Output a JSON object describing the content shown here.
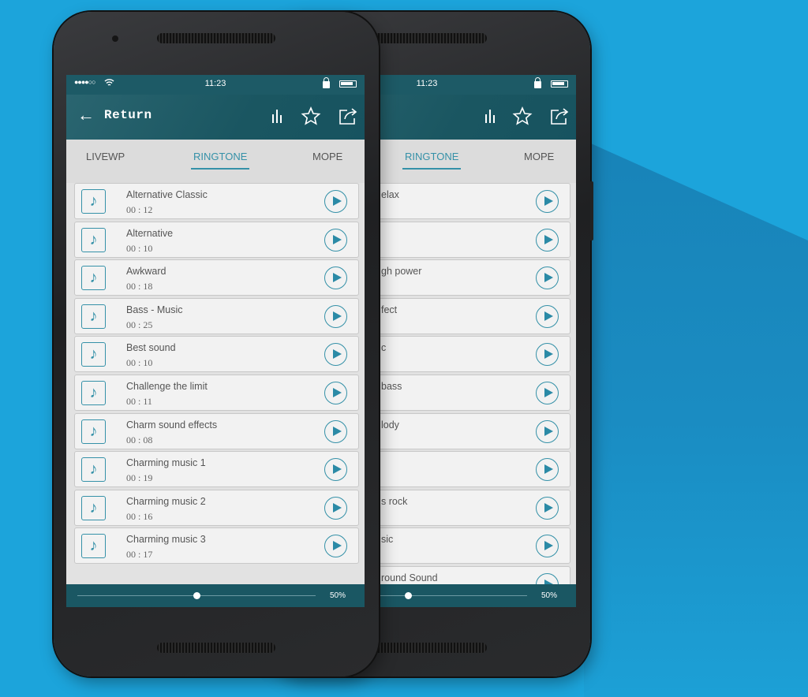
{
  "colors": {
    "background": "#1ca4db",
    "header": "#1d5a66",
    "accent": "#3591a8"
  },
  "status": {
    "time": "11:23",
    "signal": "●●●●○○"
  },
  "header": {
    "back_label": "Return",
    "icons": [
      "back-arrow-icon",
      "equalizer-icon",
      "star-icon",
      "share-icon"
    ]
  },
  "tabs": [
    {
      "label": "LIVEWP"
    },
    {
      "label": "RINGTONE",
      "active": true
    },
    {
      "label": "MOPE"
    }
  ],
  "front_list": [
    {
      "name": "Alternative Classic",
      "duration": "00 : 12"
    },
    {
      "name": "Alternative",
      "duration": "00 : 10"
    },
    {
      "name": "Awkward",
      "duration": "00 : 18"
    },
    {
      "name": "Bass - Music",
      "duration": "00 : 25"
    },
    {
      "name": "Best sound",
      "duration": "00 : 10"
    },
    {
      "name": "Challenge the limit",
      "duration": "00 : 11"
    },
    {
      "name": "Charm sound effects",
      "duration": "00 : 08"
    },
    {
      "name": "Charming music 1",
      "duration": "00 : 19"
    },
    {
      "name": "Charming music 2",
      "duration": "00 : 16"
    },
    {
      "name": "Charming music 3",
      "duration": "00 : 17"
    }
  ],
  "back_list": [
    "elax",
    "",
    "gh power",
    "fect",
    "c",
    "bass",
    "lody",
    "",
    "s rock",
    "sic",
    "round Sound"
  ],
  "volume": {
    "label": "50%",
    "value": 0.5
  }
}
